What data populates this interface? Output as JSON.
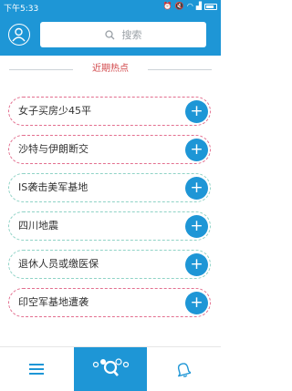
{
  "status_bar": {
    "time": "下午5:33"
  },
  "header": {
    "search_placeholder": "搜索"
  },
  "section": {
    "title": "近期热点"
  },
  "topics": [
    {
      "label": "女子买房少45平",
      "border_color": "#e36f8f"
    },
    {
      "label": "沙特与伊朗断交",
      "border_color": "#e36f8f"
    },
    {
      "label": "IS袭击美军基地",
      "border_color": "#8fd3c6"
    },
    {
      "label": "四川地震",
      "border_color": "#8fd3c6"
    },
    {
      "label": "退休人员或缴医保",
      "border_color": "#8fd3c6"
    },
    {
      "label": "印空军基地遭袭",
      "border_color": "#e36f8f"
    }
  ],
  "colors": {
    "accent": "#1e96d6",
    "section_title": "#d2484b"
  },
  "tabbar": {
    "active_tab": "search",
    "tabs": [
      {
        "name": "menu-icon"
      },
      {
        "name": "search-icon"
      },
      {
        "name": "bell-icon"
      }
    ]
  }
}
